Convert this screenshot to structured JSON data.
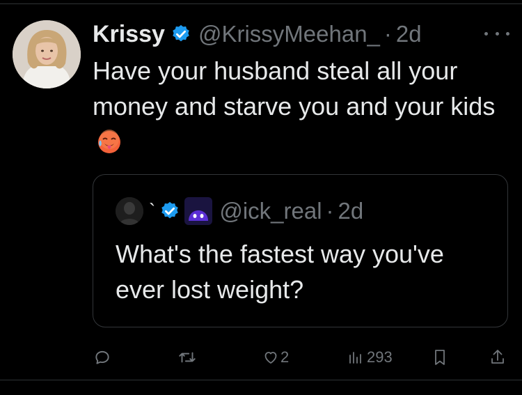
{
  "tweet": {
    "author_name": "Krissy",
    "handle": "@KrissyMeehan_",
    "separator": "·",
    "time": "2d",
    "text": "Have your husband steal all your money and starve you and your kids",
    "emoji": "hot-face-emoji"
  },
  "quote": {
    "name_fragment": "`",
    "handle": "@ick_real",
    "separator": "·",
    "time": "2d",
    "text": "What's the fastest way you've ever lost weight?"
  },
  "actions": {
    "reply_count": "",
    "retweet_count": "",
    "like_count": "2",
    "views_count": "293"
  },
  "colors": {
    "background": "#000000",
    "text": "#e7e9ea",
    "muted": "#71767b",
    "verified": "#1d9bf0",
    "border": "#333639"
  }
}
